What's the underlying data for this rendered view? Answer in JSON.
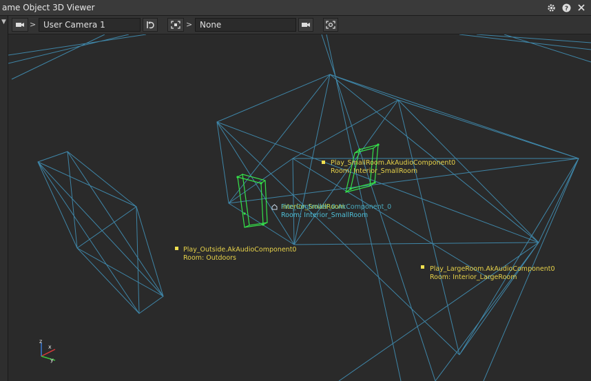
{
  "window": {
    "title": "ame Object 3D Viewer",
    "icons": [
      "gear-icon",
      "help-icon",
      "close-icon"
    ]
  },
  "toolbar": {
    "camera_button_icon": "camera-icon",
    "camera_chevron": ">",
    "camera_field": "User Camera 1",
    "reset_icon": "reset-view-icon",
    "frame_icon": "frame-select-icon",
    "target_chevron": ">",
    "target_field": "None",
    "video_icon": "video-camera-icon",
    "focus_icon": "focus-icon"
  },
  "labels": [
    {
      "name": "label-play-smallroom",
      "line1": "Play_SmallRoom.AkAudioComponent0",
      "line2": "Room: Interior_SmallRoom",
      "color": "yellow"
    },
    {
      "name": "label-listener",
      "line1": "Interior_SmallRoom",
      "line1b": "Fire_Controller_0.AkComponent_0",
      "line2": "Room: Interior_SmallRoom",
      "color": "cyan"
    },
    {
      "name": "label-play-outside",
      "line1": "Play_Outside.AkAudioComponent0",
      "line2": "Room: Outdoors",
      "color": "yellow"
    },
    {
      "name": "label-play-largeroom",
      "line1": "Play_LargeRoom.AkAudioComponent0",
      "line2": "Room: Interior_LargeRoom",
      "color": "yellow"
    }
  ],
  "axes": {
    "z": "z",
    "x": "x",
    "y": "y"
  },
  "colors": {
    "wire": "#3f86a8",
    "room_green": "#35e24a",
    "marker": "#f0e050"
  }
}
